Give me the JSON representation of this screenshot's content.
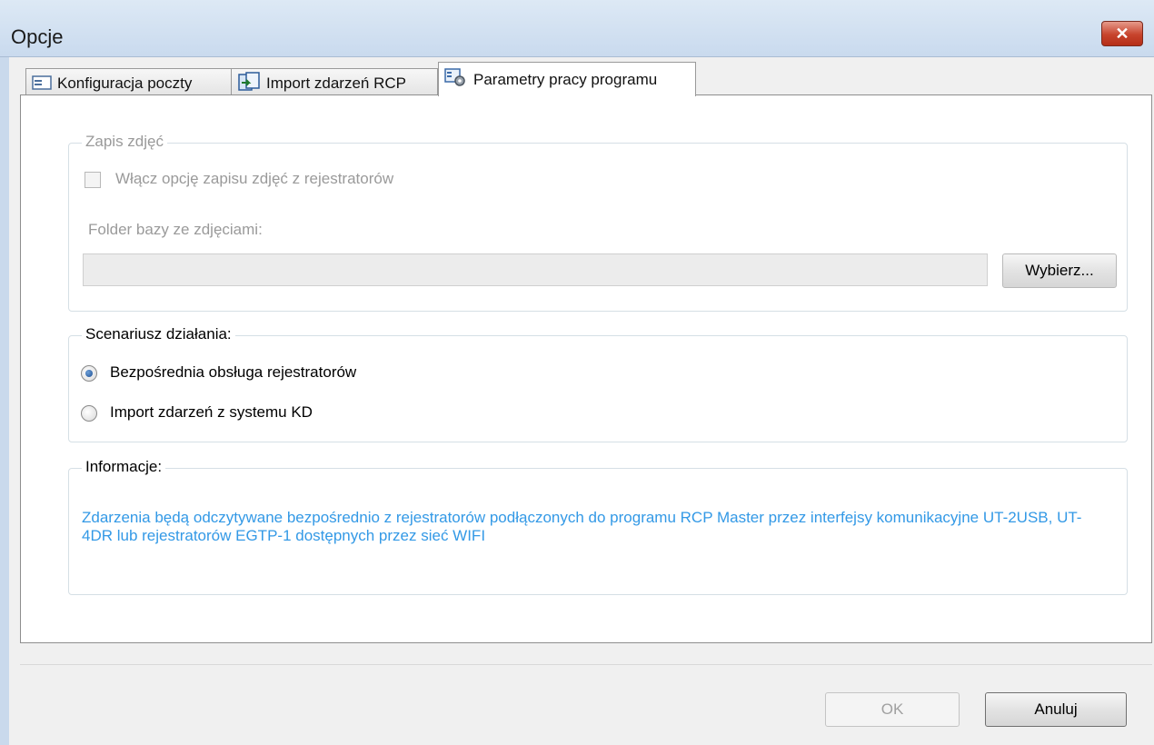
{
  "window": {
    "title": "Opcje"
  },
  "tabs": [
    {
      "label": "Konfiguracja poczty",
      "icon": "mail-icon"
    },
    {
      "label": "Import zdarzeń RCP",
      "icon": "import-icon"
    },
    {
      "label": "Parametry pracy programu",
      "icon": "settings-icon",
      "active": true
    }
  ],
  "photo_group": {
    "legend": "Zapis zdjęć",
    "checkbox_label": "Włącz opcję zapisu zdjęć z rejestratorów",
    "checked": false,
    "folder_label": "Folder bazy ze zdjęciami:",
    "folder_value": "",
    "browse_label": "Wybierz..."
  },
  "scenario_group": {
    "legend": "Scenariusz działania:",
    "options": [
      {
        "label": "Bezpośrednia obsługa rejestratorów",
        "selected": true
      },
      {
        "label": "Import zdarzeń z systemu KD",
        "selected": false
      }
    ]
  },
  "info_group": {
    "legend": "Informacje:",
    "text": "Zdarzenia będą odczytywane bezpośrednio z rejestratorów podłączonych do programu RCP Master przez interfejsy komunikacyjne UT-2USB, UT-4DR lub rejestratorów EGTP-1 dostępnych przez sieć WIFI"
  },
  "footer": {
    "ok_label": "OK",
    "cancel_label": "Anuluj"
  },
  "colors": {
    "info_text": "#3399e6",
    "close_button": "#c7432c",
    "disabled_text": "#9a9a9a"
  }
}
